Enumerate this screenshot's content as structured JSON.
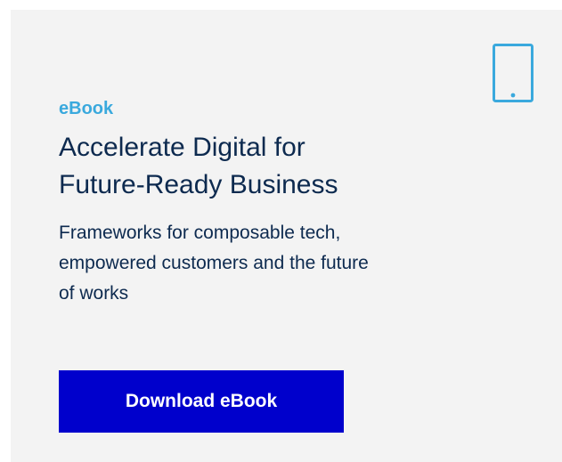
{
  "promo": {
    "eyebrow": "eBook",
    "title_lines": [
      "Accelerate Digital for",
      "Future-Ready Business"
    ],
    "description_lines": [
      "Frameworks for composable tech,",
      "empowered customers and the future",
      "of works"
    ],
    "cta_label": "Download eBook",
    "icon": "tablet-icon"
  },
  "colors": {
    "card_background": "#f3f3f3",
    "accent": "#3aa9dd",
    "text": "#0d2a4f",
    "button": "#0000cc",
    "button_text": "#ffffff"
  }
}
